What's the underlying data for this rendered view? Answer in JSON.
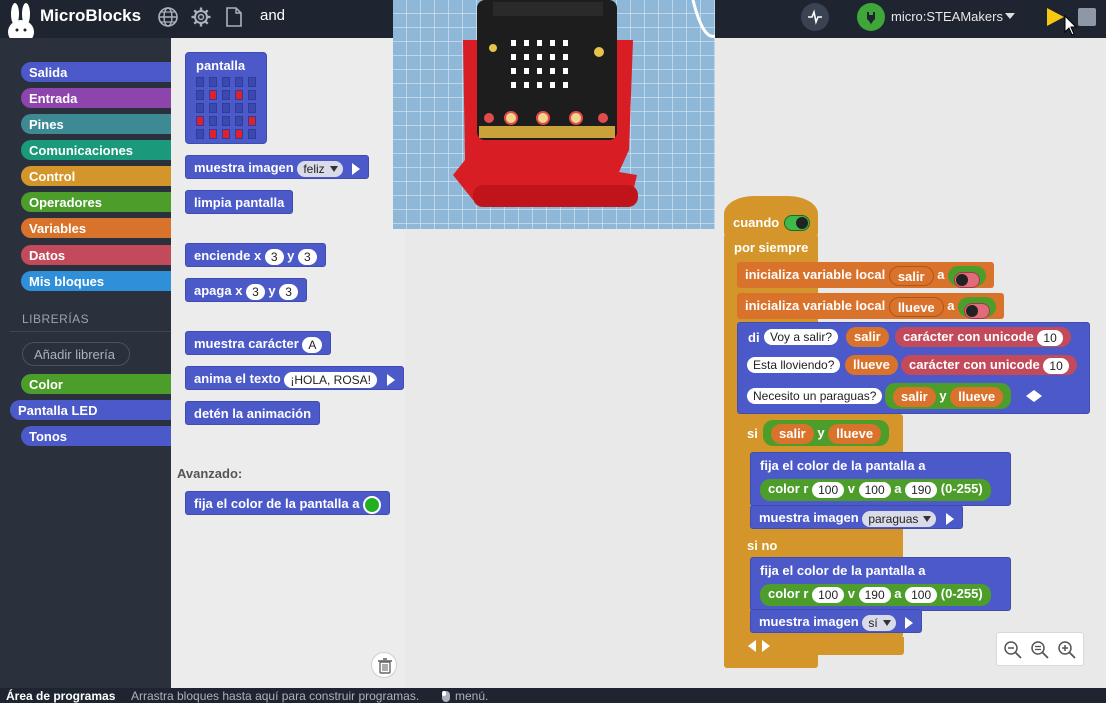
{
  "app": {
    "title": "MicroBlocks",
    "project_name": "and",
    "board_name": "micro:STEAMakers"
  },
  "categories": [
    {
      "label": "Salida",
      "color": "#4b5ac8"
    },
    {
      "label": "Entrada",
      "color": "#8e44ad"
    },
    {
      "label": "Pines",
      "color": "#3d8a95"
    },
    {
      "label": "Comunicaciones",
      "color": "#1a9a7a"
    },
    {
      "label": "Control",
      "color": "#d4962a"
    },
    {
      "label": "Operadores",
      "color": "#4d9d2b"
    },
    {
      "label": "Variables",
      "color": "#d9722b"
    },
    {
      "label": "Datos",
      "color": "#c34a5b"
    },
    {
      "label": "Mis bloques",
      "color": "#2f8fd8"
    }
  ],
  "libraries": {
    "header": "LIBRERÍAS",
    "add_label": "Añadir librería",
    "items": [
      {
        "label": "Color",
        "color": "#4d9d2b"
      },
      {
        "label": "Pantalla LED",
        "color": "#4b5ac8"
      },
      {
        "label": "Tonos",
        "color": "#4b5ac8"
      }
    ]
  },
  "palette": {
    "display_label": "pantalla",
    "led_grid": [
      [
        0,
        0,
        0,
        0,
        0
      ],
      [
        0,
        1,
        0,
        1,
        0
      ],
      [
        0,
        0,
        0,
        0,
        0
      ],
      [
        1,
        0,
        0,
        0,
        1
      ],
      [
        0,
        1,
        1,
        1,
        0
      ]
    ],
    "show_image": {
      "label": "muestra imagen",
      "value": "feliz"
    },
    "clear": "limpia pantalla",
    "plot": {
      "label": "enciende",
      "x": "x",
      "y": "y",
      "x_val": "3",
      "y_val": "3"
    },
    "unplot": {
      "label": "apaga",
      "x": "x",
      "y": "y",
      "x_val": "3",
      "y_val": "3"
    },
    "show_char": {
      "label": "muestra carácter",
      "value": "A"
    },
    "scroll": {
      "label": "anima el texto",
      "value": "¡HOLA, ROSA!"
    },
    "stop_anim": "detén la animación",
    "advanced": "Avanzado:",
    "set_color": "fija el color de la pantalla a"
  },
  "script": {
    "when": "cuando",
    "forever": "por siempre",
    "init1": {
      "label": "inicializa variable local",
      "var": "salir",
      "a": "a"
    },
    "init2": {
      "label": "inicializa variable local",
      "var": "llueve",
      "a": "a"
    },
    "ask": {
      "label": "di",
      "q1": "Voy a salir?",
      "v1": "salir",
      "char_label": "carácter con unicode",
      "code": "10",
      "q2": "Esta lloviendo?",
      "v2": "llueve",
      "q3": "Necesito un paraguas?",
      "and": "y"
    },
    "if_label": "si",
    "if_cond": {
      "a": "salir",
      "op": "y",
      "b": "llueve"
    },
    "set_color_label": "fija el color de la pantalla a",
    "color_rgb": {
      "label": "color r",
      "v": "v",
      "a": "a",
      "range": "(0-255)"
    },
    "then_rgb": [
      "100",
      "100",
      "190"
    ],
    "show_image": "muestra imagen",
    "then_image": "paraguas",
    "else_label": "si no",
    "else_rgb": [
      "100",
      "190",
      "100"
    ],
    "else_image": "sí"
  },
  "status": {
    "title": "Área de programas",
    "hint": "Arrastra bloques hasta aquí para construir programas.",
    "menu": "menú."
  },
  "colors": {
    "display": "#4b5ac8",
    "control": "#d4962a",
    "variables": "#d9722b",
    "operators": "#4d9d2b",
    "data": "#c34a5b",
    "led_on": "#e0202a"
  }
}
